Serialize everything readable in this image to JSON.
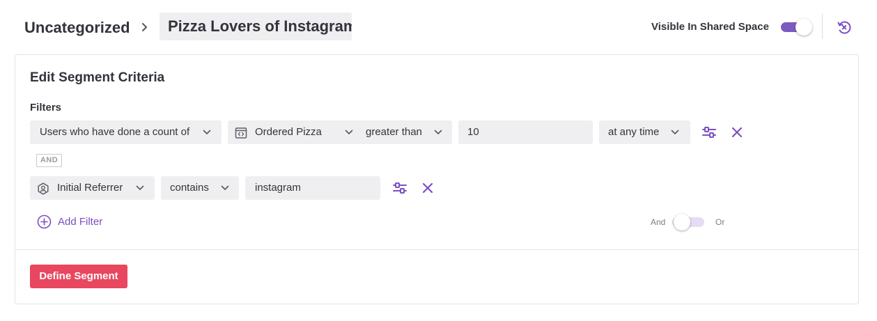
{
  "breadcrumb": {
    "root": "Uncategorized",
    "current": "Pizza Lovers of Instagram"
  },
  "shared_space": {
    "label": "Visible In Shared Space",
    "enabled": true
  },
  "card": {
    "title": "Edit Segment Criteria",
    "filters_label": "Filters"
  },
  "filter1": {
    "type": "Users who have done a count of",
    "event": "Ordered Pizza",
    "operator": "greater than",
    "value": "10",
    "time": "at any time"
  },
  "combinator": "AND",
  "filter2": {
    "property": "Initial Referrer",
    "operator": "contains",
    "value": "instagram"
  },
  "add_filter": "Add Filter",
  "logic_toggle": {
    "left": "And",
    "right": "Or",
    "selected": "And"
  },
  "define_button": "Define Segment",
  "colors": {
    "accent": "#7b4fc2",
    "toggle_on": "#7b5bbd",
    "primary_button": "#e8475f",
    "field_bg": "#efeff1"
  }
}
